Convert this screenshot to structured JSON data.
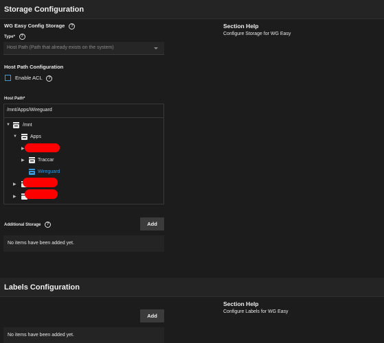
{
  "storage": {
    "header": "Storage Configuration",
    "group_label": "WG Easy Config Storage",
    "type_label": "Type",
    "type_required": "*",
    "type_value": "Host Path (Path that already exists on the system)",
    "host_path_config_label": "Host Path Configuration",
    "enable_acl_label": "Enable ACL",
    "host_path_label": "Host Path",
    "host_path_required": "*",
    "host_path_value": "/mnt/Apps/Wireguard",
    "tree": {
      "root": "/mnt",
      "apps": "Apps",
      "traccar": "Traccar",
      "wireguard": "Wireguard"
    },
    "additional_storage_label": "Additional Storage",
    "add_label": "Add",
    "empty_message": "No items have been added yet.",
    "help_title": "Section Help",
    "help_text": "Configure Storage for WG Easy"
  },
  "labels": {
    "header": "Labels Configuration",
    "add_label": "Add",
    "empty_message": "No items have been added yet.",
    "help_title": "Section Help",
    "help_text": "Configure Labels for WG Easy"
  },
  "icons": {
    "help": "help-circle-icon",
    "dataset": "dataset-icon",
    "expand": "expand-arrow-icon",
    "collapse": "collapse-arrow-icon",
    "dropdown": "chevron-down-icon"
  },
  "colors": {
    "accent": "#3a9bdc",
    "redaction": "#ff0000",
    "background": "#1c1c1c"
  }
}
